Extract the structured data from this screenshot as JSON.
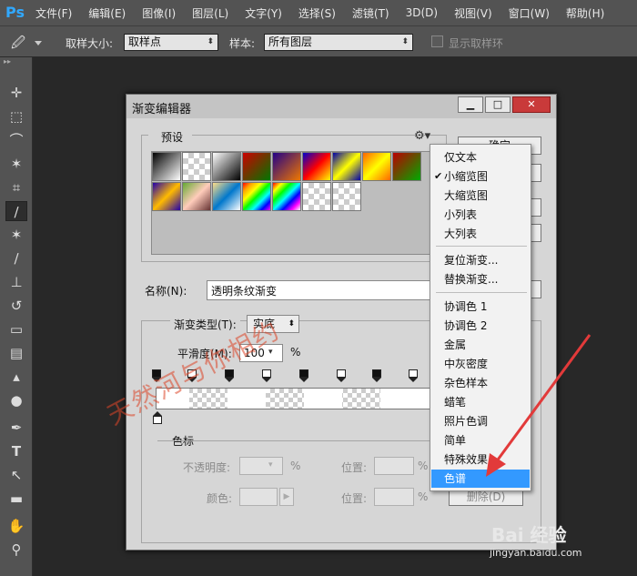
{
  "app": {
    "logo": "Ps"
  },
  "menubar": {
    "items": [
      "文件(F)",
      "编辑(E)",
      "图像(I)",
      "图层(L)",
      "文字(Y)",
      "选择(S)",
      "滤镜(T)",
      "3D(D)",
      "视图(V)",
      "窗口(W)",
      "帮助(H)"
    ]
  },
  "options": {
    "tool_icon": "eyedropper-icon",
    "sample_size_label": "取样大小:",
    "sample_size_value": "取样点",
    "sample_label": "样本:",
    "sample_value": "所有图层",
    "show_ring_label": "显示取样环"
  },
  "toolbar": {
    "icons": [
      "move-icon",
      "marquee-icon",
      "lasso-icon",
      "magic-wand-icon",
      "crop-icon",
      "eyedropper-icon",
      "healing-brush-icon",
      "brush-icon",
      "clone-stamp-icon",
      "history-brush-icon",
      "eraser-icon",
      "gradient-icon",
      "blur-icon",
      "dodge-icon",
      "pen-icon",
      "type-icon",
      "path-selection-icon",
      "rectangle-icon",
      "hand-icon",
      "zoom-icon"
    ]
  },
  "dialog": {
    "title": "渐变编辑器",
    "presets_label": "预设",
    "ok_label": "确定",
    "name_label": "名称(N):",
    "name_value": "透明条纹渐变",
    "gradient_type_label": "渐变类型(T):",
    "gradient_type_value": "实底",
    "smoothness_label": "平滑度(M):",
    "smoothness_value": "100",
    "smoothness_unit": "%",
    "color_stops_label": "色标",
    "opacity_label": "不透明度:",
    "opacity_unit": "%",
    "location_label": "位置:",
    "location_unit": "%",
    "color_label": "颜色:",
    "delete_label": "删除(D)"
  },
  "popup_menu": {
    "items": [
      "仅文本",
      "小缩览图",
      "大缩览图",
      "小列表",
      "大列表",
      "复位渐变...",
      "替换渐变...",
      "协调色 1",
      "协调色 2",
      "金属",
      "中灰密度",
      "杂色样本",
      "蜡笔",
      "照片色调",
      "简单",
      "特殊效果",
      "色谱"
    ],
    "checked": "小缩览图",
    "highlighted": "色谱"
  },
  "watermark": {
    "text": "天然河与你相约"
  },
  "branding": {
    "logo": "Bai 经验",
    "url": "jingyan.baidu.com"
  }
}
